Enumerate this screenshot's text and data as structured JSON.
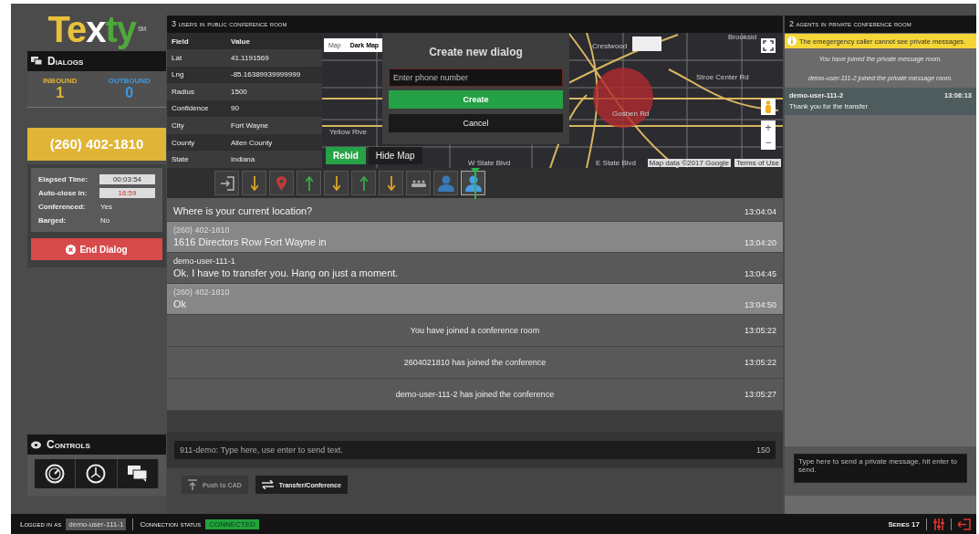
{
  "logo": {
    "parts": [
      {
        "text": "Te",
        "color": "#e9c23c"
      },
      {
        "text": "x",
        "color": "#ffffff"
      },
      {
        "text": "ty",
        "color": "#4fa83d"
      }
    ],
    "mark": "SM"
  },
  "dialogs": {
    "title": "Dialogs",
    "inbound": {
      "label": "INBOUND",
      "count": "1"
    },
    "outbound": {
      "label": "OUTBOUND",
      "count": "0"
    },
    "phone": "(260) 402-1810",
    "details": [
      {
        "label": "Elapsed Time:",
        "value": "00:03:54",
        "kind": "box"
      },
      {
        "label": "Auto-close in:",
        "value": "16:59",
        "kind": "alert"
      },
      {
        "label": "Conferenced:",
        "value": "Yes",
        "kind": "plain"
      },
      {
        "label": "Barged:",
        "value": "No",
        "kind": "plain"
      }
    ],
    "end_button": "End Dialog"
  },
  "controls": {
    "title": "Controls",
    "buttons": [
      {
        "kind": "gauge"
      },
      {
        "kind": "clock"
      },
      {
        "kind": "chat"
      }
    ]
  },
  "conference": {
    "title": "3 users in public conference room",
    "table": {
      "columns": [
        "Field",
        "Value"
      ],
      "rows": [
        [
          "Lat",
          "41.1191569"
        ],
        [
          "Lng",
          "-85.16389939999999"
        ],
        [
          "Radius",
          "1500"
        ],
        [
          "Confidence",
          "90"
        ],
        [
          "City",
          "Fort Wayne"
        ],
        [
          "County",
          "Allen County"
        ],
        [
          "State",
          "Indiana"
        ]
      ]
    },
    "map": {
      "tabs": [
        {
          "label": "Map",
          "selected": false
        },
        {
          "label": "Dark Map",
          "selected": true
        }
      ],
      "labels": [
        "Brooksid",
        "Crestwood",
        "Stroe Center Rd",
        "Goshen Rd",
        "Yellow Rive",
        "W State Blvd",
        "E State Blvd"
      ],
      "attribution": "Map data ©2017 Google",
      "terms": "Terms of Use",
      "zoom_in": "+",
      "zoom_out": "−",
      "rebid": "Rebid",
      "hide": "Hide Map"
    },
    "new_dialog": {
      "title": "Create new dialog",
      "placeholder": "Enter phone number",
      "create": "Create",
      "cancel": "Cancel"
    },
    "timeline": [
      {
        "kind": "exit"
      },
      {
        "kind": "down"
      },
      {
        "kind": "pin"
      },
      {
        "kind": "up"
      },
      {
        "kind": "down"
      },
      {
        "kind": "up"
      },
      {
        "kind": "down"
      },
      {
        "kind": "group"
      },
      {
        "kind": "person"
      },
      {
        "kind": "person",
        "selected": true
      }
    ],
    "messages": [
      {
        "kind": "agent",
        "text": "Where is your current location?",
        "time": "13:04:04"
      },
      {
        "kind": "caller",
        "author": "(260) 402-1810",
        "text": "1616 Directors Row Fort Wayne in",
        "time": "13:04:20"
      },
      {
        "kind": "agent",
        "author": "demo-user-111-1",
        "text": "Ok. I have to transfer you. Hang on just a moment.",
        "time": "13:04:45"
      },
      {
        "kind": "caller",
        "author": "(260) 402-1810",
        "text": "Ok",
        "time": "13:04:50"
      },
      {
        "kind": "system",
        "text": "You have joined a conference room",
        "time": "13:05:22"
      },
      {
        "kind": "system",
        "text": "2604021810 has joined the conference",
        "time": "13:05:22"
      },
      {
        "kind": "system",
        "text": "demo-user-111-2 has joined the conference",
        "time": "13:05:27"
      }
    ],
    "input": {
      "placeholder": "911-demo: Type here, use enter to send text.",
      "counter": "150"
    },
    "buttons": [
      {
        "label": "Push to CAD",
        "kind": "push",
        "disabled": true
      },
      {
        "label": "Transfer/Conference",
        "kind": "transfer",
        "disabled": false
      }
    ]
  },
  "private_room": {
    "title": "2 agents in private conference room",
    "notice": "The emegergency caller cannot see private messages.",
    "events": [
      "You have joined the private message room.",
      "demo-user-111-2 joined the private message room."
    ],
    "messages": [
      {
        "author": "demo-user-111-2",
        "time": "13:06:13",
        "text": "Thank you for the transfer"
      }
    ],
    "placeholder": "Type here to send a private message, hit enter to send."
  },
  "status_bar": {
    "logged_in_label": "Logged in as",
    "user": "demo-user-111-1",
    "connection_label": "Connection status",
    "connection": "CONNECTED",
    "connected": true,
    "series": "Series 17"
  }
}
